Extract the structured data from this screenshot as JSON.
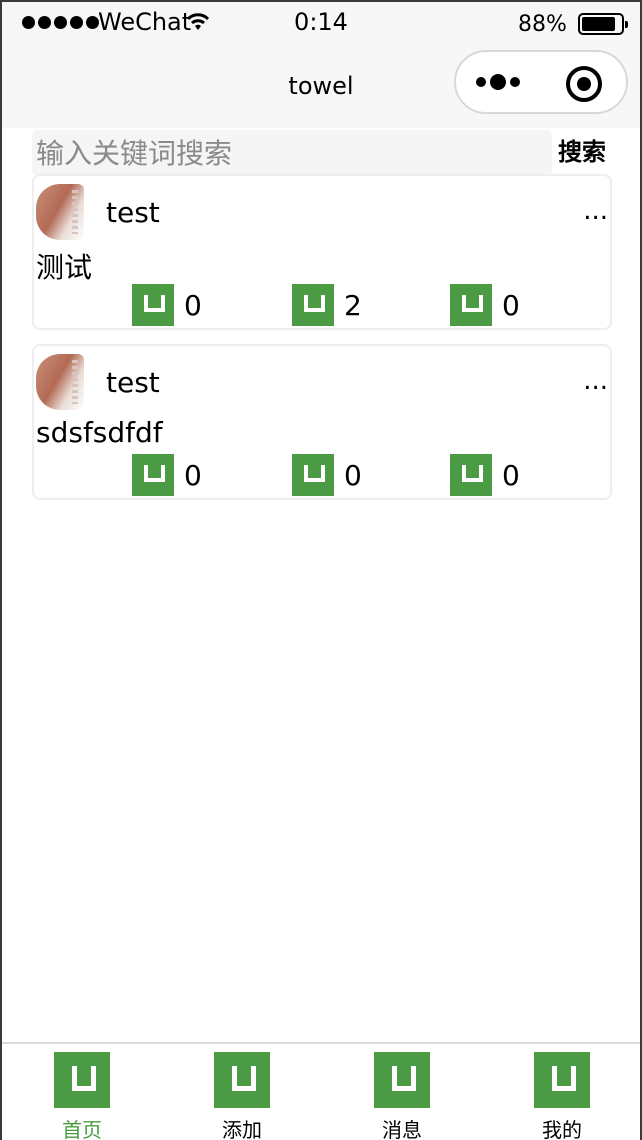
{
  "status_bar": {
    "carrier": "WeChat",
    "time": "0:14",
    "battery": "88%",
    "battery_level": 0.88
  },
  "nav": {
    "title": "towel"
  },
  "search": {
    "placeholder": "输入关键词搜索",
    "button_label": "搜索"
  },
  "posts": [
    {
      "username": "test",
      "more": "...",
      "text": "测试",
      "stats": [
        "0",
        "2",
        "0"
      ]
    },
    {
      "username": "test",
      "more": "...",
      "text": "sdsfsdfdf",
      "stats": [
        "0",
        "0",
        "0"
      ]
    }
  ],
  "tab_bar": {
    "items": [
      {
        "label": "首页",
        "active": true
      },
      {
        "label": "添加",
        "active": false
      },
      {
        "label": "消息",
        "active": false
      },
      {
        "label": "我的",
        "active": false
      }
    ],
    "active_color": "#4a9b43"
  },
  "colors": {
    "accent_green": "#4a9b43"
  }
}
